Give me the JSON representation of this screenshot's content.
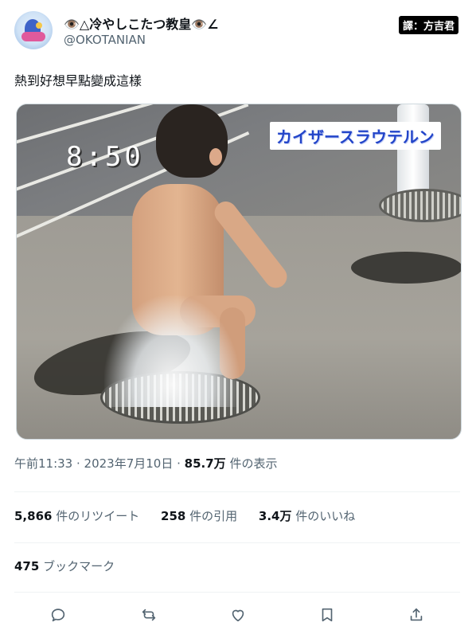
{
  "user": {
    "display_name": "👁️△冷やしこたつ教皇👁️∠",
    "handle": "@OKOTANIAN",
    "badge": "譯：方吉君"
  },
  "tweet": {
    "text": "熱到好想早點變成這樣"
  },
  "media": {
    "time_overlay": "8:50",
    "caption_overlay": "カイザースラウテルン"
  },
  "meta": {
    "time": "午前11:33",
    "separator1": " · ",
    "date": "2023年7月10日",
    "separator2": " · ",
    "views_count": "85.7万",
    "views_label": " 件の表示"
  },
  "stats": {
    "retweets_count": "5,866",
    "retweets_label": " 件のリツイート",
    "quotes_count": "258",
    "quotes_label": " 件の引用",
    "likes_count": "3.4万",
    "likes_label": " 件のいいね",
    "bookmarks_count": "475",
    "bookmarks_label": " ブックマーク"
  },
  "actions": {
    "reply_icon": "reply-icon",
    "retweet_icon": "retweet-icon",
    "like_icon": "heart-icon",
    "bookmark_icon": "bookmark-icon",
    "share_icon": "share-icon"
  },
  "colors": {
    "text_primary": "#0f1419",
    "text_secondary": "#536471",
    "caption_blue": "#2345c9"
  }
}
